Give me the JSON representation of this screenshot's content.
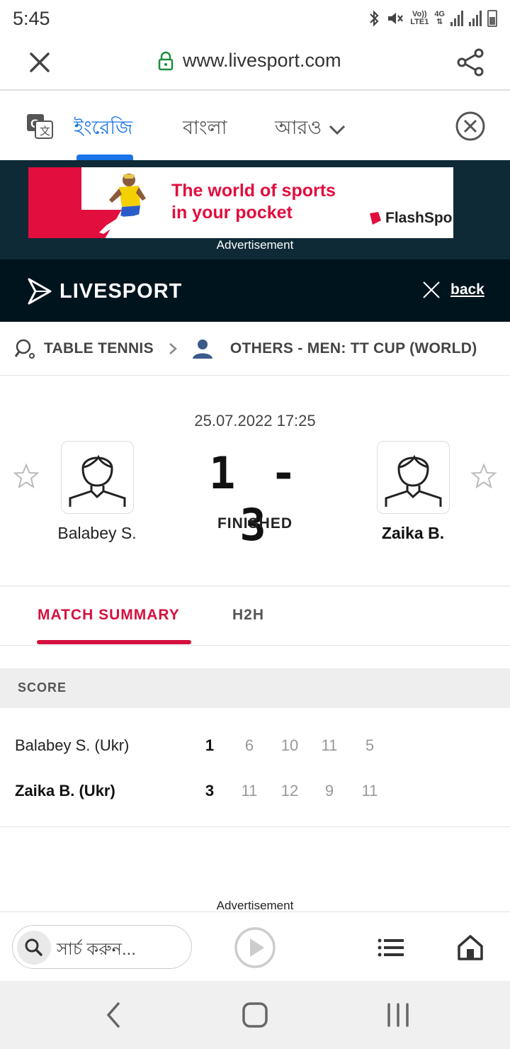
{
  "status_bar": {
    "time": "5:45",
    "volte_label": "Vo))",
    "lte_label": "LTE1",
    "network_label": "4G",
    "icons": [
      "bluetooth-icon",
      "mute-icon",
      "signal-icon",
      "battery-icon"
    ]
  },
  "browser": {
    "url": "www.livesport.com",
    "icons": [
      "close-icon",
      "lock-icon",
      "share-icon"
    ]
  },
  "translate_bar": {
    "tabs": [
      "ইংরেজি",
      "বাংলা",
      "আরও"
    ],
    "active_tab": 0,
    "icons": [
      "google-translate-icon",
      "chevron-down-icon",
      "close-circle-icon"
    ]
  },
  "ad_top": {
    "headline_line1": "The world of sports",
    "headline_line2": "in your pocket",
    "brand": "FlashSpo",
    "label": "Advertisement"
  },
  "header": {
    "logo_text": "LIVESPORT",
    "back_label": "back"
  },
  "breadcrumb": {
    "sport": "TABLE TENNIS",
    "competition": "OTHERS - MEN: TT CUP (WORLD)"
  },
  "match": {
    "datetime": "25.07.2022 17:25",
    "home_player": "Balabey S.",
    "away_player": "Zaika B.",
    "score": "1 - 3",
    "status": "FINISHED"
  },
  "tabs": {
    "summary": "MATCH SUMMARY",
    "h2h": "H2H"
  },
  "score_table": {
    "title": "SCORE",
    "rows": [
      {
        "name": "Balabey S. (Ukr)",
        "total": "1",
        "sets": [
          "6",
          "10",
          "11",
          "5"
        ]
      },
      {
        "name": "Zaika B. (Ukr)",
        "total": "3",
        "sets": [
          "11",
          "12",
          "9",
          "11"
        ]
      }
    ]
  },
  "ad_bottom": {
    "label": "Advertisement"
  },
  "bottom_bar": {
    "search_placeholder": "সার্চ করুন..."
  },
  "colors": {
    "accent_red": "#d4103e",
    "header_dark": "#00141e",
    "translate_blue": "#1a73e8"
  }
}
